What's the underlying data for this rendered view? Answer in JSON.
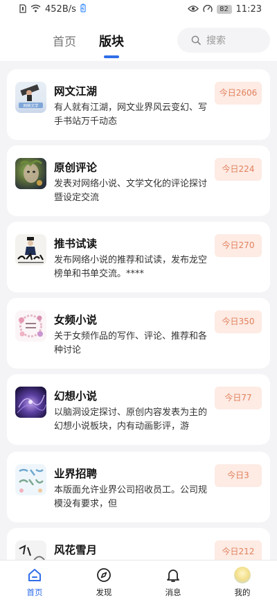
{
  "status_bar": {
    "network_speed": "452B/s",
    "battery_level": "82",
    "time": "11:23"
  },
  "header": {
    "tabs": [
      {
        "label": "首页",
        "active": false
      },
      {
        "label": "版块",
        "active": true
      }
    ],
    "search": {
      "placeholder": "搜索"
    }
  },
  "boards": [
    {
      "title": "网文江湖",
      "desc": "有人就有江湖，网文业界风云变幻、写手书站万千动态",
      "today": "今日2606",
      "icon": "wenxue-thumbnail"
    },
    {
      "title": "原创评论",
      "desc": "发表对网络小说、文学文化的评论探讨暨设定交流",
      "today": "今日224",
      "icon": "fantasy-portrait-thumbnail"
    },
    {
      "title": "推书试读",
      "desc": "发布网络小说的推荐和试读，发布龙空榜单和书单交流。****",
      "today": "今日270",
      "icon": "calligraphy-thumbnail"
    },
    {
      "title": "女频小说",
      "desc": "关于女频作品的写作、评论、推荐和各种讨论",
      "today": "今日350",
      "icon": "flower-wreath-thumbnail"
    },
    {
      "title": "幻想小说",
      "desc": "以脑洞设定探讨、原创内容发表为主的幻想小说板块，内有动画影评，游",
      "today": "今日77",
      "icon": "purple-nebula-thumbnail"
    },
    {
      "title": "业界招聘",
      "desc": "本版面允许业界公司招收员工。公司规模没有要求，但",
      "today": "今日3",
      "icon": "recruit-thumbnail"
    },
    {
      "title": "风花雪月",
      "desc": "",
      "today": "今日212",
      "icon": "ink-painting-thumbnail"
    }
  ],
  "bottom_nav": [
    {
      "label": "首页",
      "icon": "home-icon",
      "active": true
    },
    {
      "label": "发现",
      "icon": "compass-icon",
      "active": false
    },
    {
      "label": "消息",
      "icon": "bell-icon",
      "active": false
    },
    {
      "label": "我的",
      "icon": "avatar",
      "active": false
    }
  ],
  "colors": {
    "accent": "#2f6ee8",
    "badge_bg": "#fdebe4",
    "badge_text": "#e2805c",
    "page_bg": "#f4f4f6"
  }
}
